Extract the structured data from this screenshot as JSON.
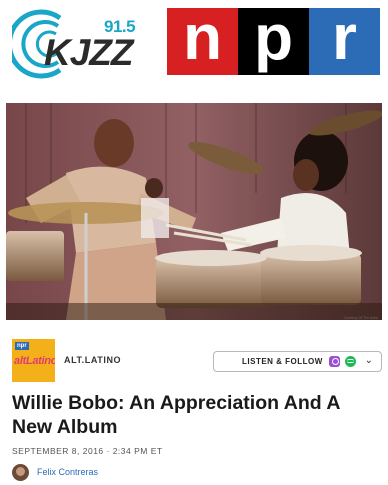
{
  "brand": {
    "station_freq": "91.5",
    "station_call": "KJZZ",
    "network_letters": [
      "n",
      "p",
      "r"
    ],
    "colors": {
      "station_blue": "#1aa6c9",
      "npr_red": "#d62021",
      "npr_black": "#000000",
      "npr_blue": "#2c6bb5"
    }
  },
  "hero": {
    "image_credit": "Courtesy Of The Artist"
  },
  "show": {
    "logo_tag": "npr",
    "logo_word": "altLatino",
    "name": "ALT.LATINO"
  },
  "listen": {
    "label": "LISTEN & FOLLOW",
    "icons": [
      "apple-podcasts-icon",
      "spotify-icon",
      "chevron-down-icon"
    ]
  },
  "article": {
    "headline": "Willie Bobo: An Appreciation And A New Album",
    "date": "SEPTEMBER 8, 2016 · 2:34 PM ET",
    "author": "Felix Contreras"
  }
}
